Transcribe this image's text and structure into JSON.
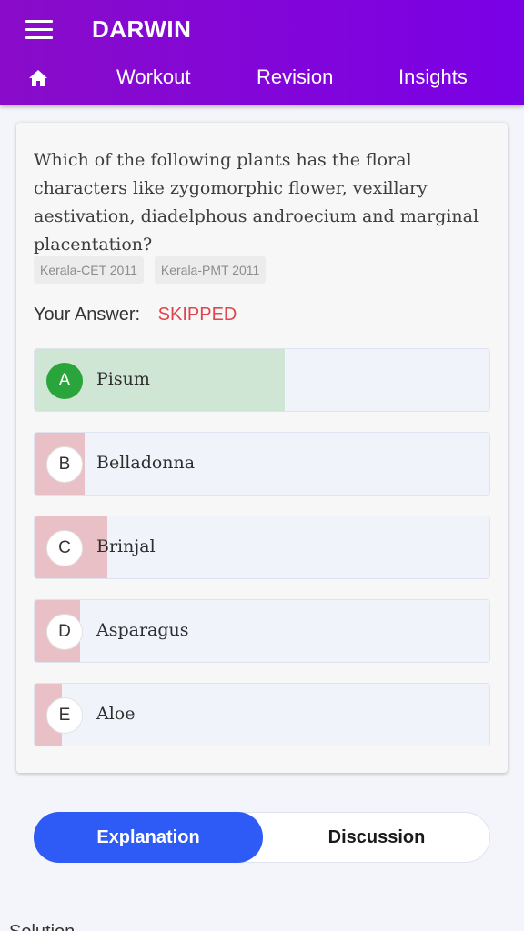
{
  "header": {
    "brand": "DARWIN",
    "tabs": [
      "Workout",
      "Revision",
      "Insights"
    ]
  },
  "question": {
    "text": "Which of the following plants has the floral characters like zygomorphic flower, vexillary aestivation, diadelphous androecium and marginal placentation?",
    "tags": [
      "Kerala-CET 2011",
      "Kerala-PMT 2011"
    ],
    "answer_label": "Your Answer:",
    "answer_value": "SKIPPED"
  },
  "options": [
    {
      "letter": "A",
      "text": "Pisum",
      "status": "correct",
      "percent": 55
    },
    {
      "letter": "B",
      "text": "Belladonna",
      "status": "wrong",
      "percent": 11
    },
    {
      "letter": "C",
      "text": "Brinjal",
      "status": "wrong",
      "percent": 16
    },
    {
      "letter": "D",
      "text": "Asparagus",
      "status": "wrong",
      "percent": 10
    },
    {
      "letter": "E",
      "text": "Aloe",
      "status": "wrong",
      "percent": 6
    }
  ],
  "toggle": {
    "explanation": "Explanation",
    "discussion": "Discussion"
  },
  "solution_label": "Solution"
}
